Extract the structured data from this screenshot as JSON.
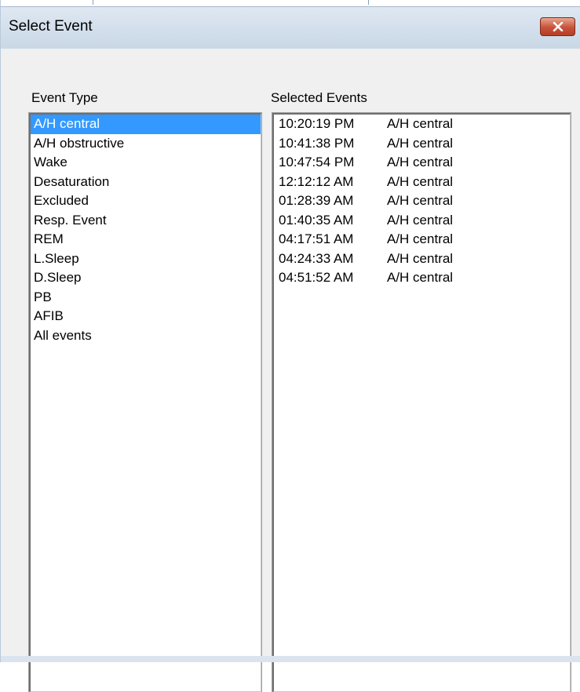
{
  "dialog": {
    "title": "Select Event",
    "close_icon": "close-icon"
  },
  "event_type": {
    "label": "Event Type",
    "selected_index": 0,
    "items": [
      "A/H central",
      "A/H obstructive",
      "Wake",
      "Desaturation",
      "Excluded",
      "Resp. Event",
      "REM",
      "L.Sleep",
      "D.Sleep",
      "PB",
      "AFIB",
      "All events"
    ]
  },
  "selected_events": {
    "label": "Selected Events",
    "rows": [
      {
        "time": "10:20:19 PM",
        "type": "A/H central"
      },
      {
        "time": "10:41:38 PM",
        "type": "A/H central"
      },
      {
        "time": "10:47:54 PM",
        "type": "A/H central"
      },
      {
        "time": "12:12:12 AM",
        "type": "A/H central"
      },
      {
        "time": "01:28:39 AM",
        "type": "A/H central"
      },
      {
        "time": "01:40:35 AM",
        "type": "A/H central"
      },
      {
        "time": "04:17:51 AM",
        "type": "A/H central"
      },
      {
        "time": "04:24:33 AM",
        "type": "A/H central"
      },
      {
        "time": "04:51:52 AM",
        "type": "A/H central"
      }
    ]
  },
  "colors": {
    "selection": "#3399ff",
    "close_button": "#c7523a"
  }
}
